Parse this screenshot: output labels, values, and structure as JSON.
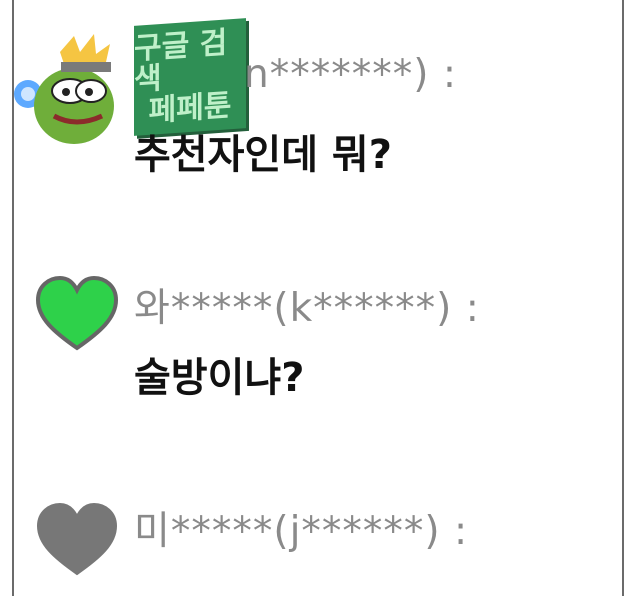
{
  "comments": [
    {
      "username": "n*******)  :",
      "message": "추천자인데 뭐?",
      "avatar": "pepe-frog-avatar"
    },
    {
      "username": "와*****(k******)  :",
      "message": "술방이냐?",
      "avatar": "green-heart-icon"
    },
    {
      "username": "미*****(j******)  :",
      "message": "…",
      "avatar": "gray-heart-icon"
    }
  ],
  "badge": {
    "line1": "구글 검색",
    "line2": "페페툰"
  },
  "colors": {
    "heart_green": "#2ed14a",
    "heart_gray": "#777777",
    "badge_green": "#2f8f55"
  }
}
